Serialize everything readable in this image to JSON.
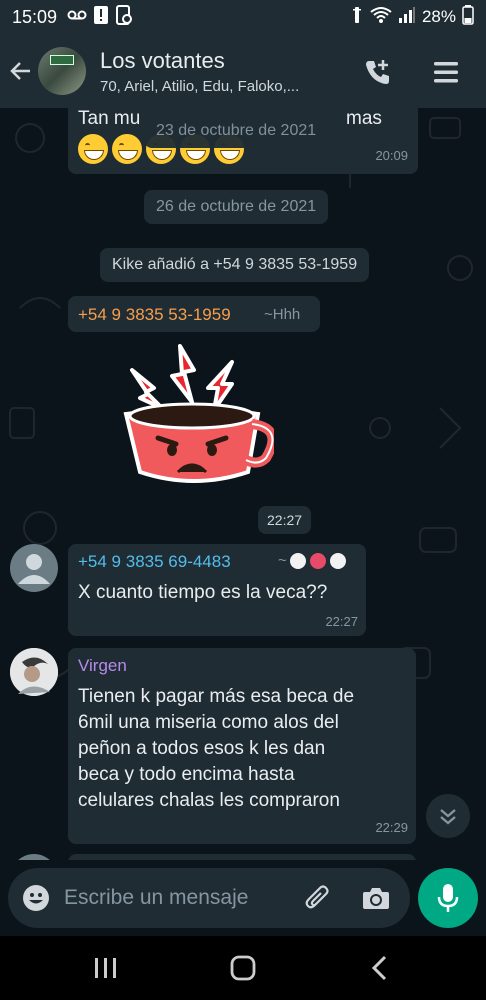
{
  "status_bar": {
    "time": "15:09",
    "battery": "28%",
    "icons_left": [
      "voicemail-icon",
      "alert-icon",
      "screenshot-icon"
    ],
    "icons_right": [
      "alarm-icon",
      "wifi-icon",
      "signal-icon",
      "battery-icon"
    ]
  },
  "header": {
    "title": "Los votantes",
    "subtitle": "70, Ariel, Atilio, Edu, Faloko,...",
    "icons": [
      "back-arrow-icon",
      "add-call-icon",
      "menu-icon"
    ]
  },
  "chat": {
    "top_message": {
      "text": "Tan mu",
      "text_tail": "mas",
      "time": "20:09",
      "emoji_count": 5
    },
    "floating_date": "23 de octubre de 2021",
    "date_separator": "26 de octubre de 2021",
    "system_message": "Kike añadió a +54 9 3835 53-1959",
    "sticker_message": {
      "sender": "+54 9 3835 53-1959",
      "push_name": "~Hhh",
      "time": "22:27",
      "sticker": "angry-coffee-cup-sticker"
    },
    "message_2": {
      "sender": "+54 9 3835 69-4483",
      "push_name": "~",
      "text": "X cuanto tiempo es la veca??",
      "time": "22:27"
    },
    "message_3": {
      "sender": "Virgen",
      "lines": [
        "Tienen k pagar más esa beca de",
        "6mil una miseria como alos del",
        "peñon a todos esos k les dan",
        "beca y todo encima hasta",
        "celulares chalas les compraron"
      ],
      "time": "22:29"
    }
  },
  "input": {
    "placeholder": "Escribe un mensaje",
    "value": ""
  },
  "colors": {
    "bubble": "#1f2c34",
    "background": "#0b141a",
    "accent": "#00a884",
    "sender_orange": "#f79e4d",
    "sender_blue": "#53bdeb",
    "sender_purple": "#b68bea"
  }
}
